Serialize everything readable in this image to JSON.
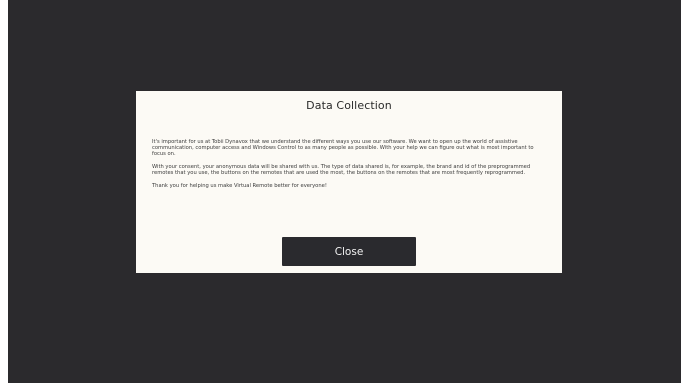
{
  "dialog": {
    "title": "Data Collection",
    "paragraphs": [
      "It's important for us at Tobii Dynavox that we understand the different ways you use our software. We want to open up the world of assistive communication, computer access and Windows Control to as many people as possible. With your help we can figure out what is most important to focus on.",
      "With your consent, your anonymous data will be shared with us. The type of data shared is, for example, the brand and id of the preprogrammed remotes that you use, the buttons on the remotes that are used the most, the buttons on the remotes that are most frequently reprogrammed.",
      "Thank you for helping us make Virtual Remote better for everyone!"
    ],
    "close_label": "Close"
  },
  "colors": {
    "background": "#2b2a2d",
    "dialog": "#fcfaf5",
    "button": "#2a2a2e",
    "button_text": "#f2f2f2"
  }
}
